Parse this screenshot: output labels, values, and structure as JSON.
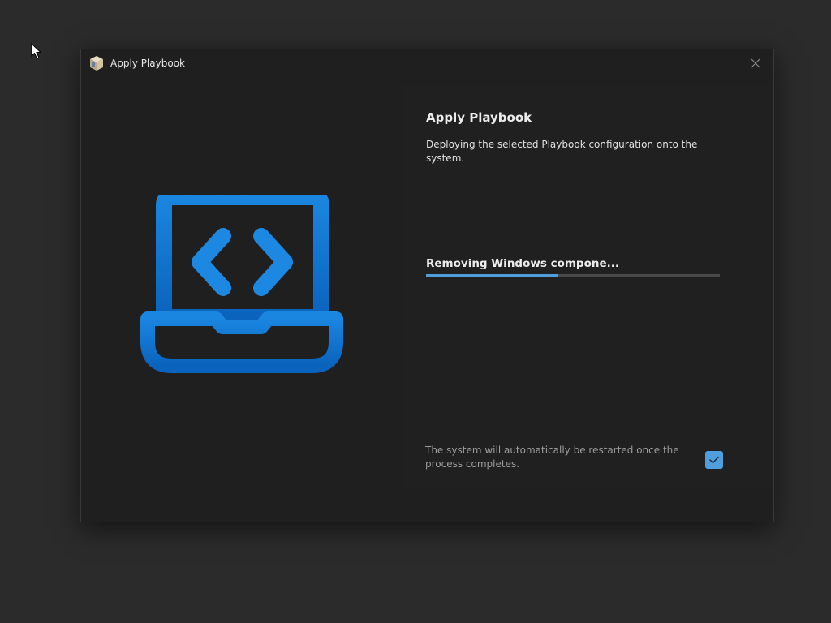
{
  "window": {
    "title": "Apply Playbook",
    "app_icon": "package-box-icon",
    "close_icon": "close-icon"
  },
  "left": {
    "hero_icon": "laptop-code-icon",
    "accent_color": "#0a6ccb"
  },
  "content": {
    "heading": "Apply Playbook",
    "description": "Deploying the selected Playbook configuration onto the system.",
    "status": "Removing Windows compone...",
    "progress": 0.45,
    "restart_note": "The system will automatically be restarted once the process completes.",
    "restart_checkbox_checked": true,
    "checkbox_color": "#4f9fdc"
  }
}
